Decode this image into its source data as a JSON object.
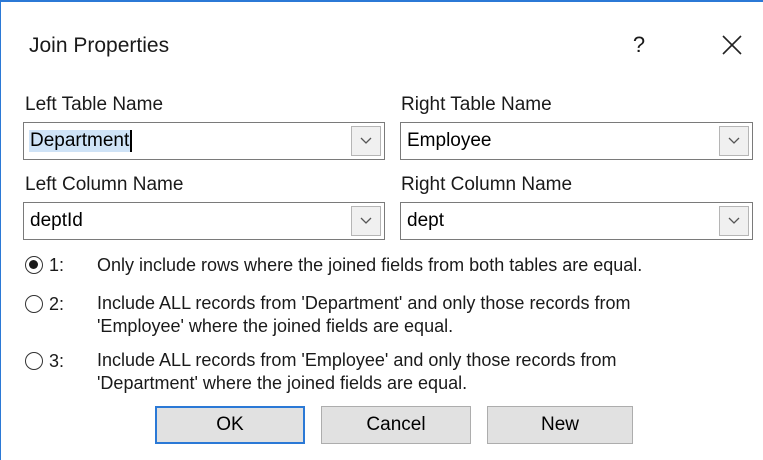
{
  "dialog": {
    "title": "Join Properties",
    "help_label": "?"
  },
  "left_table": {
    "label": "Left Table Name",
    "value": "Department"
  },
  "right_table": {
    "label": "Right Table Name",
    "value": "Employee"
  },
  "left_column": {
    "label": "Left Column Name",
    "value": "deptId"
  },
  "right_column": {
    "label": "Right Column Name",
    "value": "dept"
  },
  "options": [
    {
      "number": "1:",
      "line1": "Only include rows where the joined fields from both tables are equal.",
      "line2": "",
      "selected": true
    },
    {
      "number": "2:",
      "line1": "Include ALL records from 'Department' and only those records from",
      "line2": "'Employee' where the joined fields are equal.",
      "selected": false
    },
    {
      "number": "3:",
      "line1": "Include ALL records from 'Employee' and only those records from",
      "line2": "'Department' where the joined fields are equal.",
      "selected": false
    }
  ],
  "buttons": {
    "ok": "OK",
    "cancel": "Cancel",
    "new": "New"
  },
  "icons": {
    "close": "close-icon",
    "dropdown": "chevron-down-icon"
  },
  "colors": {
    "accent": "#2b79d6",
    "selection": "#cfe3f7"
  }
}
